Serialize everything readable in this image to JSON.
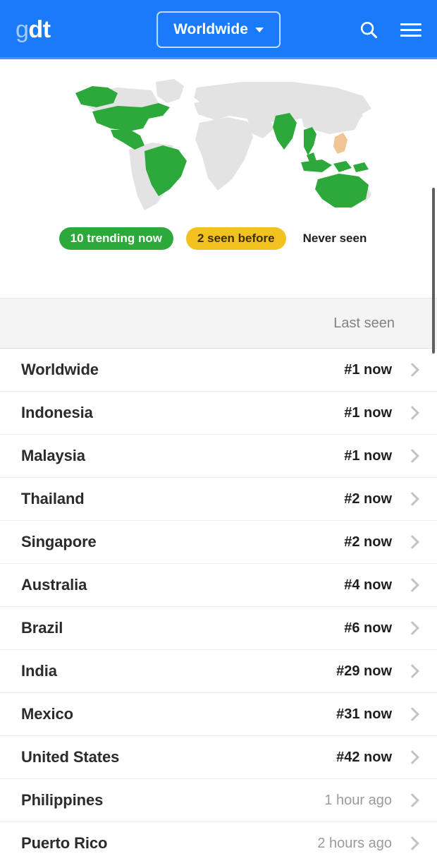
{
  "header": {
    "logo_light": "g",
    "logo_bold": "dt",
    "region_button": "Worldwide",
    "caret_icon": "chevron-down-icon",
    "search_icon": "search-icon",
    "menu_icon": "hamburger-menu-icon"
  },
  "map": {
    "highlight_color": "#2da93b",
    "seen_color": "#f0c493",
    "land_color": "#e3e3e3",
    "legend": [
      {
        "label": "10 trending now",
        "style": "trending",
        "color": "#2da93b"
      },
      {
        "label": "2 seen before",
        "style": "seen",
        "color": "#f4c220"
      },
      {
        "label": "Never seen",
        "style": "never",
        "color": "#212121"
      }
    ]
  },
  "table": {
    "column_header": "Last seen",
    "chevron_icon": "chevron-right-icon",
    "rows": [
      {
        "name": "Worldwide",
        "value": "#1 now",
        "muted": false
      },
      {
        "name": "Indonesia",
        "value": "#1 now",
        "muted": false
      },
      {
        "name": "Malaysia",
        "value": "#1 now",
        "muted": false
      },
      {
        "name": "Thailand",
        "value": "#2 now",
        "muted": false
      },
      {
        "name": "Singapore",
        "value": "#2 now",
        "muted": false
      },
      {
        "name": "Australia",
        "value": "#4 now",
        "muted": false
      },
      {
        "name": "Brazil",
        "value": "#6 now",
        "muted": false
      },
      {
        "name": "India",
        "value": "#29 now",
        "muted": false
      },
      {
        "name": "Mexico",
        "value": "#31 now",
        "muted": false
      },
      {
        "name": "United States",
        "value": "#42 now",
        "muted": false
      },
      {
        "name": "Philippines",
        "value": "1 hour ago",
        "muted": true
      },
      {
        "name": "Puerto Rico",
        "value": "2 hours ago",
        "muted": true
      }
    ]
  }
}
